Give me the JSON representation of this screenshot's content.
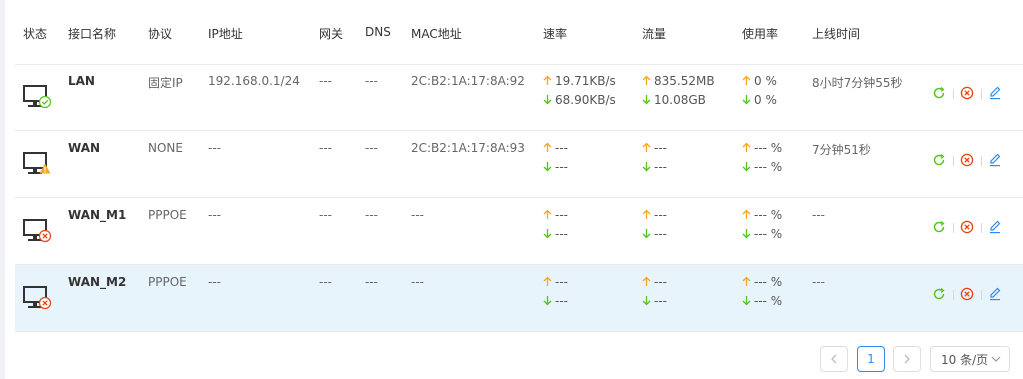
{
  "table": {
    "headers": {
      "status": "状态",
      "name": "接口名称",
      "protocol": "协议",
      "ip": "IP地址",
      "gateway": "网关",
      "dns": "DNS",
      "mac": "MAC地址",
      "rate": "速率",
      "traffic": "流量",
      "usage": "使用率",
      "online": "上线时间"
    },
    "rows": [
      {
        "status": "online",
        "name": "LAN",
        "protocol": "固定IP",
        "ip": "192.168.0.1/24",
        "gateway": "---",
        "dns": "---",
        "mac": "2C:B2:1A:17:8A:92",
        "rate_up": "19.71KB/s",
        "rate_down": "68.90KB/s",
        "traffic_up": "835.52MB",
        "traffic_down": "10.08GB",
        "usage_up": "0 %",
        "usage_down": "0 %",
        "online": "8小时7分钟55秒"
      },
      {
        "status": "warning",
        "name": "WAN",
        "protocol": "NONE",
        "ip": "---",
        "gateway": "---",
        "dns": "---",
        "mac": "2C:B2:1A:17:8A:93",
        "rate_up": "---",
        "rate_down": "---",
        "traffic_up": "---",
        "traffic_down": "---",
        "usage_up": "--- %",
        "usage_down": "--- %",
        "online": "7分钟51秒"
      },
      {
        "status": "error",
        "name": "WAN_M1",
        "protocol": "PPPOE",
        "ip": "---",
        "gateway": "---",
        "dns": "---",
        "mac": "---",
        "rate_up": "---",
        "rate_down": "---",
        "traffic_up": "---",
        "traffic_down": "---",
        "usage_up": "--- %",
        "usage_down": "--- %",
        "online": "---"
      },
      {
        "status": "error",
        "name": "WAN_M2",
        "protocol": "PPPOE",
        "ip": "---",
        "gateway": "---",
        "dns": "---",
        "mac": "---",
        "rate_up": "---",
        "rate_down": "---",
        "traffic_up": "---",
        "traffic_down": "---",
        "usage_up": "--- %",
        "usage_down": "--- %",
        "online": "---"
      }
    ],
    "row_actions": [
      "restart-icon",
      "delete-icon",
      "edit-icon"
    ]
  },
  "pagination": {
    "prev_icon": "chevron-left-icon",
    "current_page": "1",
    "next_icon": "chevron-right-icon",
    "page_size": "10 条/页"
  },
  "colors": {
    "online": "#52c41a",
    "warning": "#f5a623",
    "error": "#ed4014",
    "primary": "#2d8cf0",
    "highlight_row": "#e8f4fc"
  }
}
